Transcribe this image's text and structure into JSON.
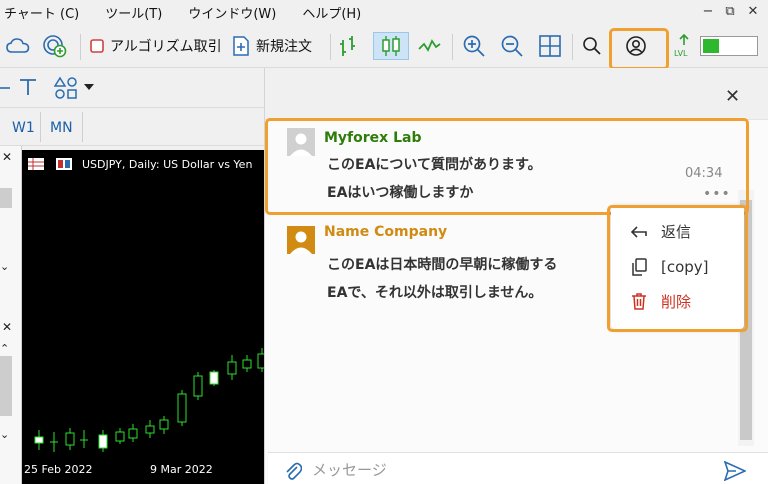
{
  "menu": {
    "items": [
      "チャート (C)",
      "ツール(T)",
      "ウインドウ(W)",
      "ヘルプ(H)"
    ]
  },
  "toolbar": {
    "algo_label": "アルゴリズム取引",
    "new_order_label": "新規注文"
  },
  "timeframes": [
    "W1",
    "MN"
  ],
  "chart": {
    "title": "USDJPY, Daily:  US Dollar vs Yen",
    "dates": [
      "25 Feb 2022",
      "9 Mar 2022"
    ]
  },
  "chat": {
    "messages": [
      {
        "sender": "Myforex Lab",
        "lines": [
          "このEAについて質問があります。",
          "EAはいつ稼働しますか"
        ],
        "time": "04:34"
      },
      {
        "sender": "Name Company",
        "lines": [
          "このEAは日本時間の早朝に稼働する",
          "EAで、それ以外は取引しません。"
        ]
      }
    ],
    "menu": {
      "reply": "返信",
      "copy": "[copy]",
      "delete": "削除"
    },
    "input_placeholder": "メッセージ"
  },
  "colors": {
    "highlight": "#f0a030",
    "sender1": "#2e7d0a",
    "sender2": "#d18a12",
    "delete": "#d03020"
  }
}
